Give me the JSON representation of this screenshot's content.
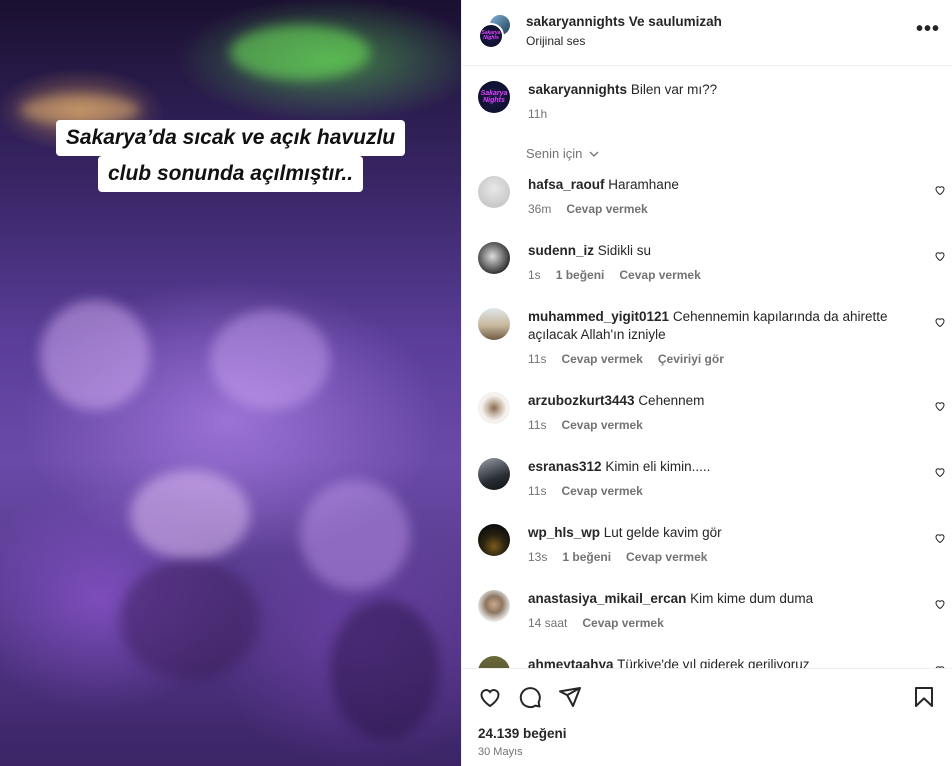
{
  "media": {
    "caption_line1": "Sakarya’da sıcak ve açık  havuzlu",
    "caption_line2": "club sonunda açılmıştır.."
  },
  "header": {
    "title": "sakaryannights Ve saulumizah",
    "subtitle": "Orijinal ses",
    "more_icon": "more-horizontal-icon",
    "logo_text": "Sakarya Nights"
  },
  "post": {
    "user": "sakaryannights",
    "text": "Bilen var mı??",
    "time": "11h",
    "sort_label": "Senin için"
  },
  "comments": [
    {
      "user": "hafsa_raouf",
      "text": "Haramhane",
      "time": "36m",
      "likes": "",
      "reply": "Cevap vermek",
      "translate": ""
    },
    {
      "user": "sudenn_iz",
      "text": "Sidikli su",
      "time": "1s",
      "likes": "1 beğeni",
      "reply": "Cevap vermek",
      "translate": ""
    },
    {
      "user": "muhammed_yigit0121",
      "text": "Cehennemin kapılarında da ahirette açılacak Allah'ın izniyle",
      "time": "11s",
      "likes": "",
      "reply": "Cevap vermek",
      "translate": "Çeviriyi gör"
    },
    {
      "user": "arzubozkurt3443",
      "text": "Cehennem",
      "time": "11s",
      "likes": "",
      "reply": "Cevap vermek",
      "translate": ""
    },
    {
      "user": "esranas312",
      "text": "Kimin eli kimin.....",
      "time": "11s",
      "likes": "",
      "reply": "Cevap vermek",
      "translate": ""
    },
    {
      "user": "wp_hls_wp",
      "text": "Lut gelde kavim gör",
      "time": "13s",
      "likes": "1 beğeni",
      "reply": "Cevap vermek",
      "translate": ""
    },
    {
      "user": "anastasiya_mikail_ercan",
      "text": "Kim kime dum duma",
      "time": "14 saat",
      "likes": "",
      "reply": "Cevap vermek",
      "translate": ""
    },
    {
      "user": "ahmeytaahya",
      "text": "Türkiye'de yıl giderek geriliyoruz",
      "time": "",
      "likes": "",
      "reply": "",
      "translate": ""
    }
  ],
  "footer": {
    "likes": "24.139 beğeni",
    "date": "30 Mayıs"
  },
  "colors": {
    "text": "#262626",
    "muted": "#737373",
    "border": "#efefef",
    "brand_pink": "#e040fb"
  }
}
